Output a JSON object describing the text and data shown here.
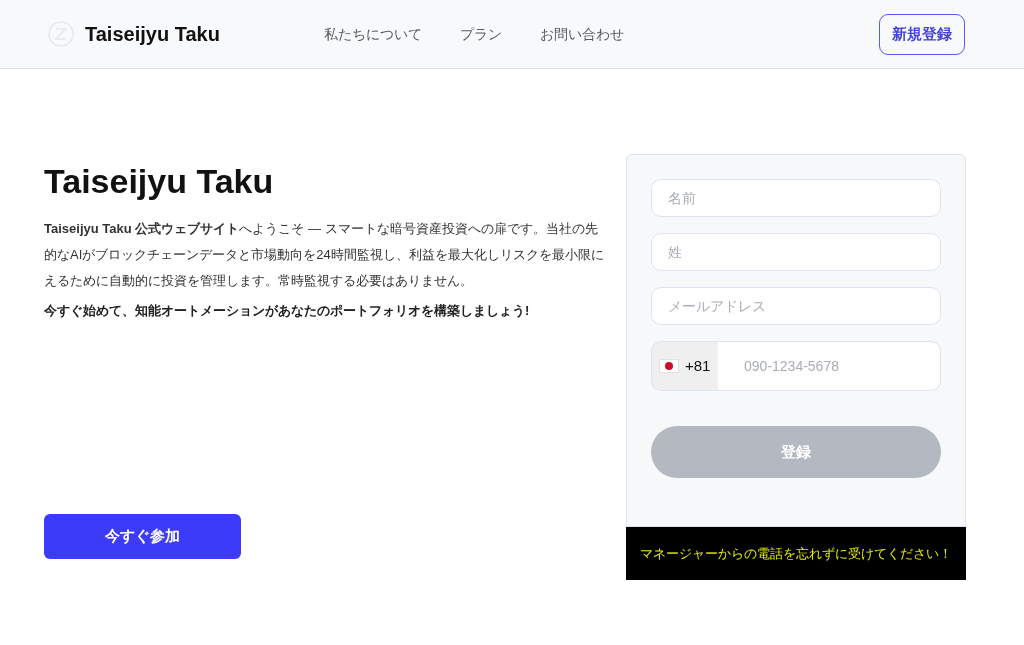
{
  "header": {
    "brand": "Taiseijyu Taku",
    "nav": [
      "私たちについて",
      "プラン",
      "お問い合わせ"
    ],
    "signup_button": "新規登録"
  },
  "hero": {
    "title": "Taiseijyu Taku",
    "intro_lines": [
      "**Taiseijyu Taku 公式ウェブサイト**へようこそ — スマートな暗号資産投資への扉です。当社の先",
      "的なAIがブロックチェーンデータと市場動向を24時間監視し、利益を最大化しリスクを最小限に",
      "えるために自動的に投資を管理します。常時監視する必要はありません。"
    ],
    "call_to_action": "今すぐ始めて、知能オートメーションがあなたのポートフォリオを構築しましょう!",
    "join_button": "今すぐ参加"
  },
  "form": {
    "fields": [
      {
        "kind": "text",
        "placeholder": "名前"
      },
      {
        "kind": "text",
        "placeholder": "姓"
      },
      {
        "kind": "text",
        "placeholder": "メールアドレス"
      },
      {
        "kind": "phone",
        "country_code": "+81",
        "placeholder": "090-1234-5678"
      }
    ],
    "submit": {
      "label": "登録",
      "disabled": true
    }
  },
  "banner": "マネージャーからの電話を忘れずに受けてください！"
}
